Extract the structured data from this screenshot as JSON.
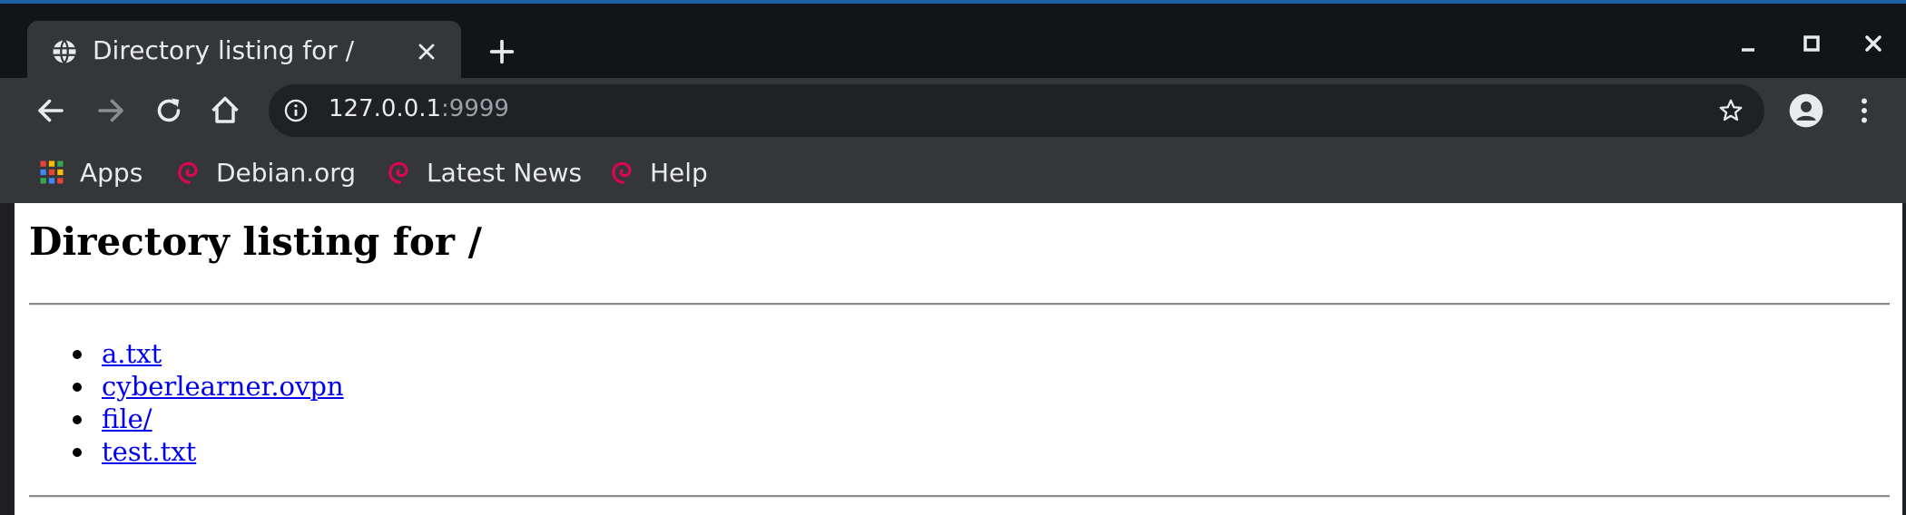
{
  "tab": {
    "title": "Directory listing for /"
  },
  "omnibox": {
    "host": "127.0.0.1",
    "port": ":9999"
  },
  "bookmarks": [
    {
      "label": "Apps",
      "icon": "apps-grid-icon"
    },
    {
      "label": "Debian.org",
      "icon": "debian-swirl-icon"
    },
    {
      "label": "Latest News",
      "icon": "debian-swirl-icon"
    },
    {
      "label": "Help",
      "icon": "debian-swirl-icon"
    }
  ],
  "page": {
    "heading": "Directory listing for /",
    "entries": [
      "a.txt",
      "cyberlearner.ovpn",
      "file/",
      "test.txt"
    ]
  },
  "colors": {
    "link": "#0000ee",
    "debian_red": "#d70751",
    "chrome_dark": "#35363a",
    "omnibox_bg": "#202124"
  }
}
